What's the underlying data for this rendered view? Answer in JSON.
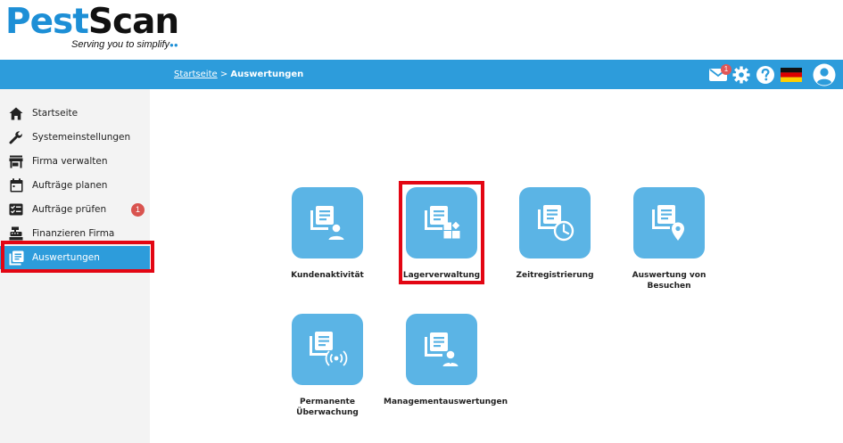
{
  "brand": {
    "name_part1": "Pest",
    "name_part2": "Scan",
    "tagline": "Serving you to simplify",
    "tagline_mark": "●●"
  },
  "header": {
    "breadcrumb_home": "Startseite",
    "breadcrumb_separator": " > ",
    "breadcrumb_current": "Auswertungen",
    "mail_badge_count": "1",
    "language_flag": "de-flag",
    "icons": [
      "mail-icon",
      "gear-icon",
      "help-icon",
      "flag-de-icon",
      "user-avatar-icon"
    ]
  },
  "sidebar": {
    "items": [
      {
        "label": "Startseite",
        "icon": "home-icon"
      },
      {
        "label": "Systemeinstellungen",
        "icon": "wrench-icon"
      },
      {
        "label": "Firma verwalten",
        "icon": "store-icon"
      },
      {
        "label": "Aufträge planen",
        "icon": "calendar-icon"
      },
      {
        "label": "Aufträge prüfen",
        "icon": "checklist-icon",
        "badge": "1"
      },
      {
        "label": "Finanzieren Firma",
        "icon": "cash-register-icon"
      },
      {
        "label": "Auswertungen",
        "icon": "report-icon",
        "active": true
      }
    ]
  },
  "tiles": [
    {
      "label_line1": "Kundenaktivität",
      "label_line2": "",
      "icon": "report-user-icon"
    },
    {
      "label_line1": "Lagerverwaltung",
      "label_line2": "",
      "icon": "report-shapes-icon"
    },
    {
      "label_line1": "Zeitregistrierung",
      "label_line2": "",
      "icon": "report-clock-icon"
    },
    {
      "label_line1": "Auswertung von",
      "label_line2": "Besuchen",
      "icon": "report-location-icon"
    },
    {
      "label_line1": "Permanente",
      "label_line2": "Überwachung",
      "icon": "report-signal-icon"
    },
    {
      "label_line1": "Managementauswertungen",
      "label_line2": "",
      "icon": "report-manager-icon"
    }
  ],
  "colors": {
    "accent": "#2d9cdb",
    "tile": "#5bb4e5",
    "highlight": "#e30613",
    "badge": "#d9534f"
  }
}
